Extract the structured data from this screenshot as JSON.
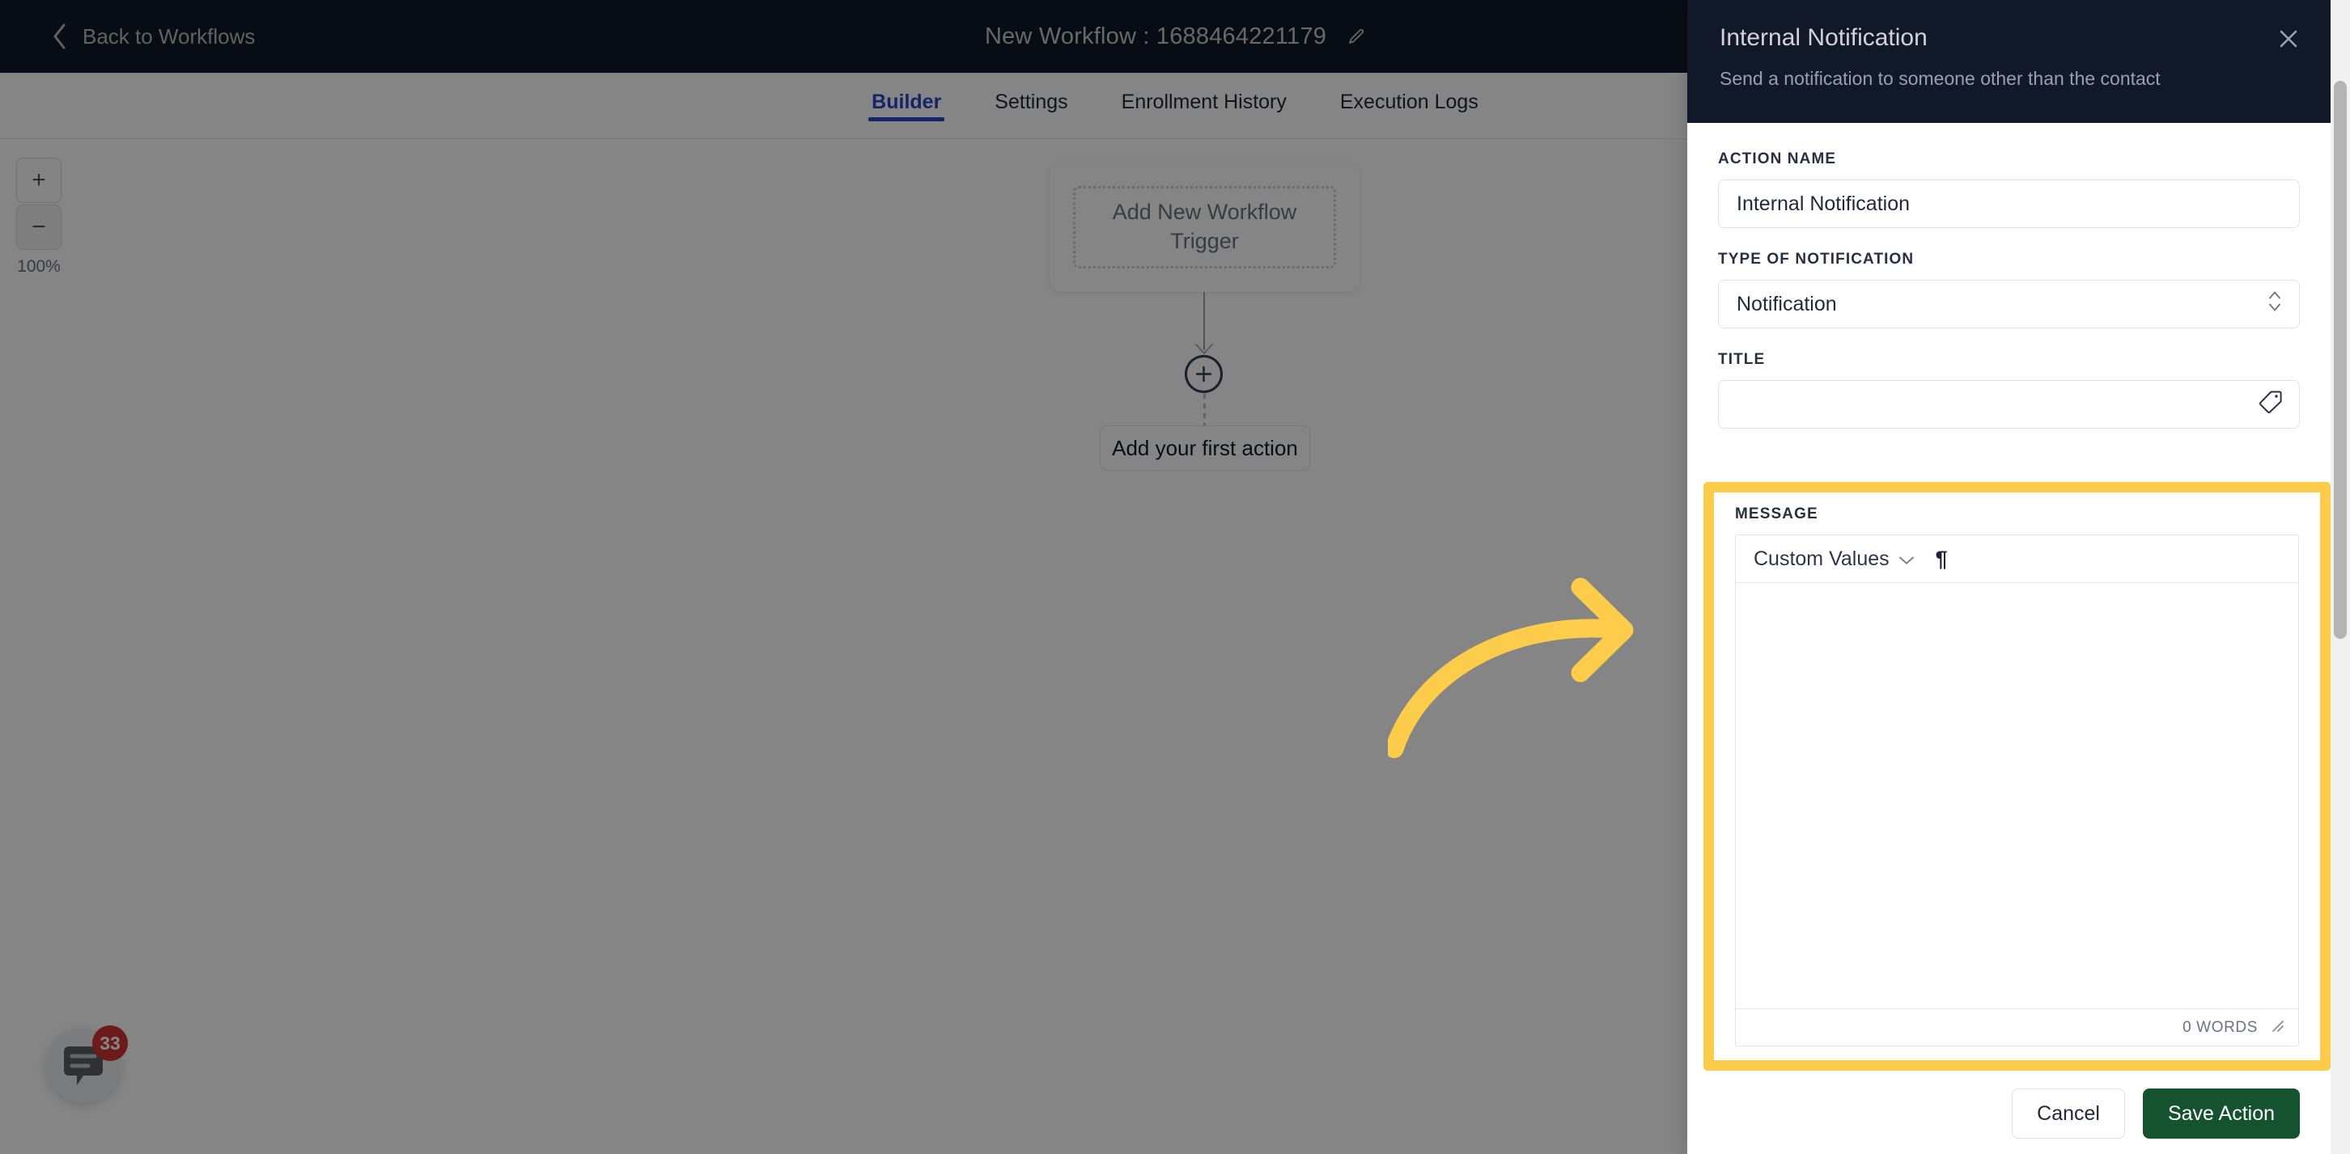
{
  "topbar": {
    "back_label": "Back to Workflows",
    "back_icon": "chevron-left-icon",
    "workflow_title": "New Workflow : 1688464221179",
    "edit_icon": "pencil-icon"
  },
  "tabs": [
    {
      "label": "Builder",
      "active": true
    },
    {
      "label": "Settings",
      "active": false
    },
    {
      "label": "Enrollment History",
      "active": false
    },
    {
      "label": "Execution Logs",
      "active": false
    }
  ],
  "canvas": {
    "zoom_in_label": "+",
    "zoom_out_label": "−",
    "zoom_level": "100%",
    "trigger_label": "Add New Workflow Trigger",
    "add_node_icon": "plus-circle-icon",
    "first_action_label": "Add your first action"
  },
  "chat_widget": {
    "icon": "chat-bubble-icon",
    "unread_count": "33"
  },
  "panel": {
    "title": "Internal Notification",
    "subtitle": "Send a notification to someone other than the contact",
    "close_icon": "close-icon",
    "fields": {
      "action_name": {
        "label": "ACTION NAME",
        "value": "Internal Notification",
        "placeholder": ""
      },
      "type_of_notification": {
        "label": "TYPE OF NOTIFICATION",
        "value": "Notification",
        "stepper_icon": "chevron-up-down-icon"
      },
      "title": {
        "label": "TITLE",
        "value": "",
        "placeholder": "",
        "suffix_icon": "tag-icon"
      },
      "message": {
        "label": "MESSAGE",
        "value": "",
        "toolbar": {
          "custom_values_label": "Custom Values",
          "custom_values_icon": "chevron-down-icon",
          "paragraph_icon": "pilcrow-icon",
          "paragraph_glyph": "¶"
        },
        "word_count": "0 WORDS",
        "resize_icon": "resize-handle-icon"
      }
    },
    "footer": {
      "cancel_label": "Cancel",
      "save_label": "Save Action"
    }
  },
  "annotation": {
    "arrow_icon": "curved-arrow-right-icon",
    "highlight_color": "#FDCC4B",
    "arrow_color": "#FDCC4B"
  },
  "colors": {
    "topbar_bg": "#111827",
    "tab_active": "#2746C4",
    "save_button": "#14532D",
    "badge_red": "#D03232",
    "highlight_yellow": "#FDCC4B"
  }
}
